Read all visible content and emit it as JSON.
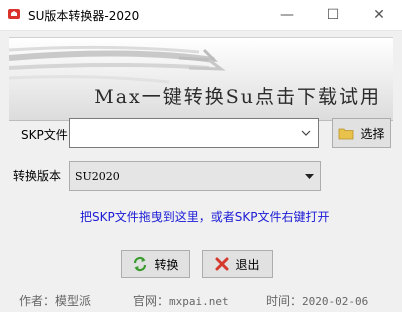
{
  "window": {
    "title": "SU版本转换器-2020",
    "controls": {
      "minimize": "—",
      "maximize": "☐",
      "close": "✕"
    }
  },
  "banner": {
    "text": "Max一键转换Su点击下载试用"
  },
  "form": {
    "skp_label": "SKP文件",
    "skp_value": "",
    "browse_label": "选择",
    "version_label": "转换版本",
    "version_value": "SU2020"
  },
  "hint": "把SKP文件拖曳到这里，或者SKP文件右键打开",
  "actions": {
    "convert_label": "转换",
    "exit_label": "退出"
  },
  "footer": {
    "author_label": "作者：",
    "author": "模型派",
    "site_label": "官网：",
    "site": "mxpai.net",
    "time_label": "时间：",
    "time": "2020-02-06"
  },
  "colors": {
    "hint": "#1a1ad6",
    "convert_icon": "#3a9c2c",
    "exit_icon": "#d43a2e",
    "folder_icon": "#e8c24a"
  }
}
